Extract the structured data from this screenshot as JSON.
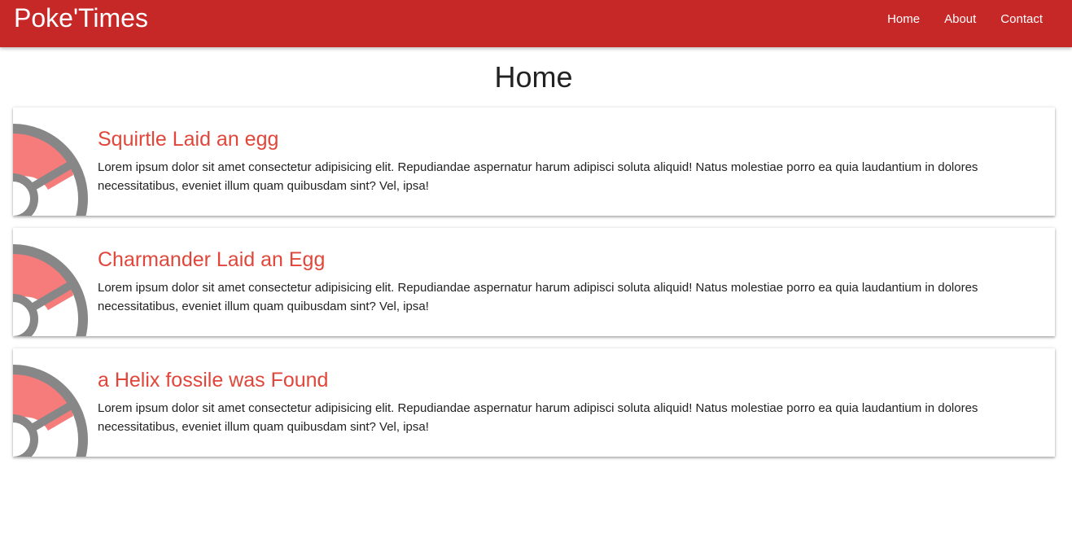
{
  "navbar": {
    "brand": "Poke'Times",
    "links": [
      "Home",
      "About",
      "Contact"
    ],
    "color": "#c62828"
  },
  "page": {
    "title": "Home"
  },
  "posts": [
    {
      "title": "Squirtle Laid an egg",
      "body": "Lorem ipsum dolor sit amet consectetur adipisicing elit. Repudiandae aspernatur harum adipisci soluta aliquid! Natus molestiae porro ea quia laudantium in dolores necessitatibus, eveniet illum quam quibusdam sint? Vel, ipsa!",
      "image_icon": "pokeball-icon"
    },
    {
      "title": "Charmander Laid an Egg",
      "body": "Lorem ipsum dolor sit amet consectetur adipisicing elit. Repudiandae aspernatur harum adipisci soluta aliquid! Natus molestiae porro ea quia laudantium in dolores necessitatibus, eveniet illum quam quibusdam sint? Vel, ipsa!",
      "image_icon": "pokeball-icon"
    },
    {
      "title": "a Helix fossile was Found",
      "body": "Lorem ipsum dolor sit amet consectetur adipisicing elit. Repudiandae aspernatur harum adipisci soluta aliquid! Natus molestiae porro ea quia laudantium in dolores necessitatibus, eveniet illum quam quibusdam sint? Vel, ipsa!",
      "image_icon": "pokeball-icon"
    }
  ],
  "colors": {
    "post_title": "#e0463a",
    "pokeball_red": "#f67c7c",
    "pokeball_gray": "#878787"
  }
}
